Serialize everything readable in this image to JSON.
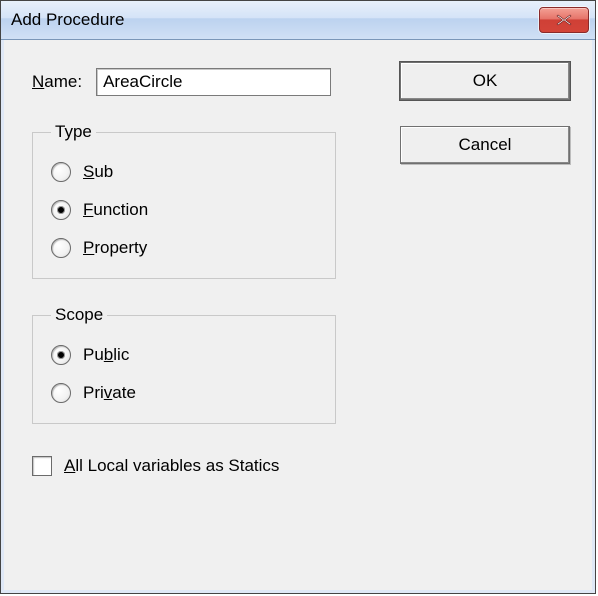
{
  "window": {
    "title": "Add Procedure"
  },
  "name": {
    "label_prefix": "N",
    "label_rest": "ame:",
    "value": "AreaCircle"
  },
  "buttons": {
    "ok": "OK",
    "cancel": "Cancel"
  },
  "type_group": {
    "legend": "Type",
    "options": {
      "sub": {
        "u": "S",
        "rest": "ub",
        "checked": false
      },
      "function": {
        "u": "F",
        "rest": "unction",
        "checked": true
      },
      "property": {
        "u": "P",
        "rest": "roperty",
        "checked": false
      }
    }
  },
  "scope_group": {
    "legend": "Scope",
    "options": {
      "public": {
        "pre": "Pu",
        "u": "b",
        "rest": "lic",
        "checked": true
      },
      "private": {
        "pre": "Pri",
        "u": "v",
        "rest": "ate",
        "checked": false
      }
    }
  },
  "statics": {
    "u": "A",
    "rest": "ll Local variables as Statics",
    "checked": false
  }
}
